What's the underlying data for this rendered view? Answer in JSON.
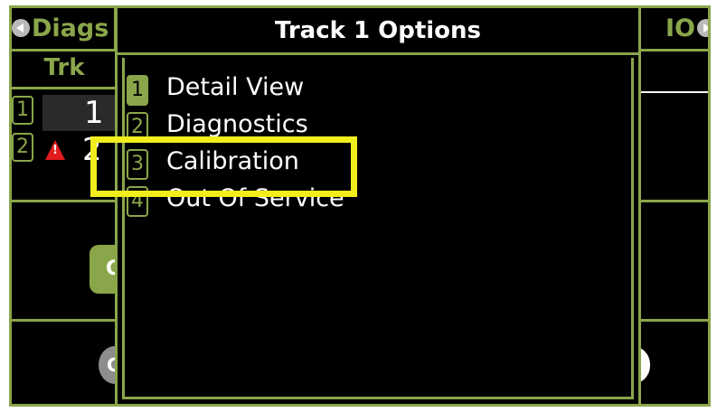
{
  "header": {
    "left_title": "Diags",
    "right_title": "IO"
  },
  "track_table": {
    "column_header": "Trk",
    "rows": [
      {
        "number": "1",
        "value": "1"
      },
      {
        "number": "2",
        "value": "2"
      }
    ]
  },
  "background_buttons": {
    "green_label": "C",
    "grey_label": "G"
  },
  "dialog": {
    "title": "Track 1 Options",
    "items": [
      {
        "number": "1",
        "label": "Detail View"
      },
      {
        "number": "2",
        "label": "Diagnostics"
      },
      {
        "number": "3",
        "label": "Calibration"
      },
      {
        "number": "4",
        "label": "Out Of Service"
      }
    ]
  },
  "colors": {
    "accent": "#8aa64a",
    "highlight": "#f2ee1d",
    "warning": "#e01b1b",
    "background": "#000000"
  },
  "icons": [
    "nav-left-icon",
    "nav-right-icon",
    "warning-icon"
  ]
}
